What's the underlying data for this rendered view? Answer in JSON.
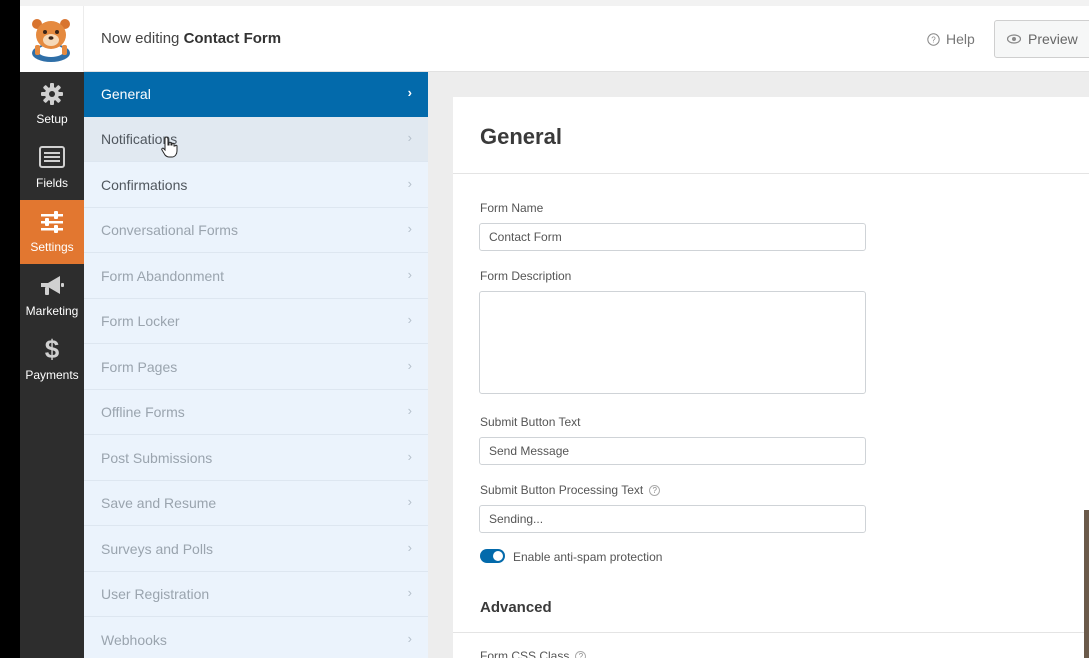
{
  "header": {
    "title_prefix": "Now editing",
    "form_name": "Contact Form",
    "help_label": "Help",
    "preview_label": "Preview"
  },
  "leftnav": {
    "items": [
      {
        "label": "Setup",
        "icon": "gear-icon"
      },
      {
        "label": "Fields",
        "icon": "fields-list-icon"
      },
      {
        "label": "Settings",
        "icon": "sliders-icon",
        "active": true
      },
      {
        "label": "Marketing",
        "icon": "megaphone-icon"
      },
      {
        "label": "Payments",
        "icon": "dollar-icon"
      }
    ]
  },
  "sidebar": {
    "items": [
      {
        "label": "General",
        "active": true
      },
      {
        "label": "Notifications"
      },
      {
        "label": "Confirmations"
      },
      {
        "label": "Conversational Forms"
      },
      {
        "label": "Form Abandonment"
      },
      {
        "label": "Form Locker"
      },
      {
        "label": "Form Pages"
      },
      {
        "label": "Offline Forms"
      },
      {
        "label": "Post Submissions"
      },
      {
        "label": "Save and Resume"
      },
      {
        "label": "Surveys and Polls"
      },
      {
        "label": "User Registration"
      },
      {
        "label": "Webhooks"
      }
    ],
    "chevron": "›"
  },
  "panel": {
    "title": "General",
    "form_name_label": "Form Name",
    "form_name_value": "Contact Form",
    "form_description_label": "Form Description",
    "form_description_value": "",
    "submit_text_label": "Submit Button Text",
    "submit_text_value": "Send Message",
    "processing_text_label": "Submit Button Processing Text",
    "processing_text_value": "Sending...",
    "antispam_label": "Enable anti-spam protection",
    "antispam_enabled": true,
    "advanced_title": "Advanced",
    "css_class_label": "Form CSS Class"
  },
  "colors": {
    "accent_blue": "#036aab",
    "nav_active_orange": "#e27730",
    "nav_bg": "#2d2d2d",
    "sidebar_bg": "#ebf3fc"
  }
}
